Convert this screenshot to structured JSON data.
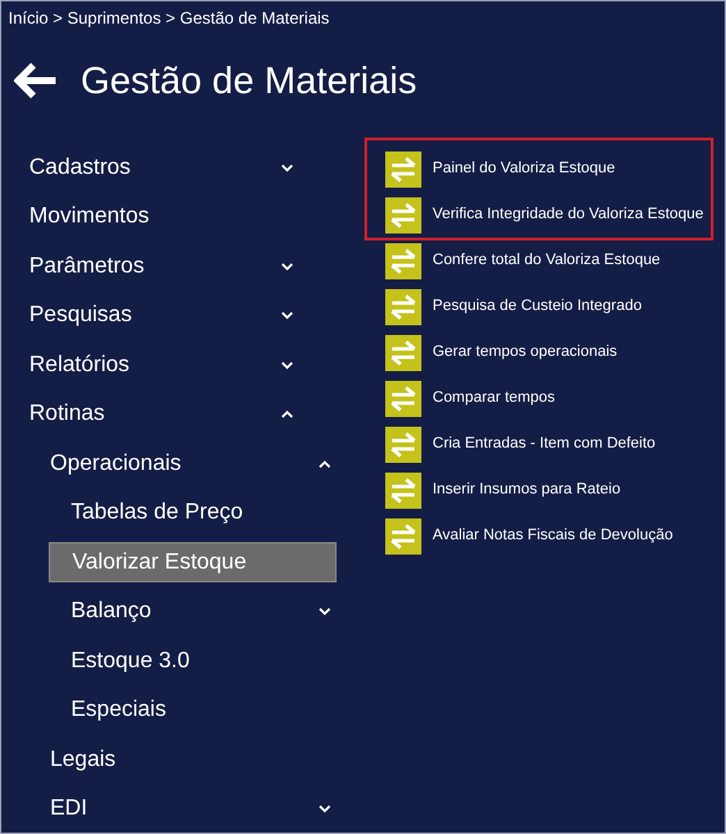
{
  "breadcrumb": "Início > Suprimentos > Gestão de Materiais",
  "title": "Gestão de Materiais",
  "menu": [
    {
      "label": "Cadastros",
      "selected": false,
      "expanded": false
    },
    {
      "label": "Movimentos",
      "selected": false
    },
    {
      "label": "Parâmetros",
      "selected": false,
      "expanded": false
    },
    {
      "label": "Pesquisas",
      "selected": false,
      "expanded": false
    },
    {
      "label": "Relatórios",
      "selected": false,
      "expanded": false
    },
    {
      "label": "Rotinas",
      "selected": false,
      "expanded": true,
      "children": [
        {
          "label": "Operacionais",
          "selected": false,
          "expanded": true,
          "children": [
            {
              "label": "Tabelas de Preço",
              "selected": false
            },
            {
              "label": "Valorizar Estoque",
              "selected": true
            },
            {
              "label": "Balanço",
              "selected": false,
              "expanded": false
            },
            {
              "label": "Estoque 3.0",
              "selected": false
            },
            {
              "label": "Especiais",
              "selected": false
            }
          ]
        },
        {
          "label": "Legais",
          "selected": false
        },
        {
          "label": "EDI",
          "selected": false,
          "expanded": false
        }
      ]
    }
  ],
  "highlighted_actions": [
    {
      "label": "Painel do Valoriza Estoque"
    },
    {
      "label": "Verifica Integridade do Valoriza Estoque"
    }
  ],
  "actions": [
    {
      "label": "Confere total do Valoriza Estoque"
    },
    {
      "label": "Pesquisa de Custeio Integrado"
    },
    {
      "label": "Gerar tempos operacionais"
    },
    {
      "label": "Comparar tempos"
    },
    {
      "label": "Cria Entradas - Item com Defeito"
    },
    {
      "label": "Inserir Insumos para Rateio"
    },
    {
      "label": "Avaliar Notas Fiscais de Devolução"
    }
  ]
}
